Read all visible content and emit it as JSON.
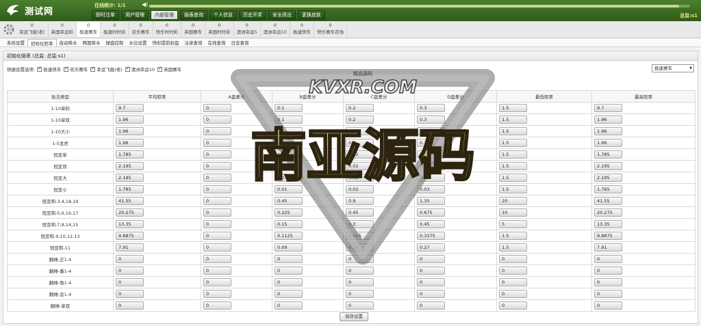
{
  "app": {
    "logo_text": "测试网",
    "online_text": "在线统计: 1/1",
    "balance_text": "总监:s1"
  },
  "progress": {
    "value_percent": 98
  },
  "nav": [
    {
      "label": "即时注单",
      "active": false
    },
    {
      "label": "用户管理",
      "active": false
    },
    {
      "label": "内部管理",
      "active": true
    },
    {
      "label": "报表查询",
      "active": false
    },
    {
      "label": "个人信息",
      "active": false
    },
    {
      "label": "历史开奖",
      "active": false
    },
    {
      "label": "安全退出",
      "active": false
    },
    {
      "label": "更换皮肤",
      "active": false
    }
  ],
  "games": [
    {
      "count": "0",
      "name": "幸运飞艇(老)",
      "active": false
    },
    {
      "count": "0",
      "name": "英国幸运彩",
      "active": false
    },
    {
      "count": "0",
      "name": "极速赛车",
      "active": true
    },
    {
      "count": "0",
      "name": "极速时时彩",
      "active": false
    },
    {
      "count": "0",
      "name": "欢乐赛车",
      "active": false
    },
    {
      "count": "0",
      "name": "快乐时时彩",
      "active": false
    },
    {
      "count": "0",
      "name": "英国赛车",
      "active": false
    },
    {
      "count": "0",
      "name": "英国时时彩",
      "active": false
    },
    {
      "count": "0",
      "name": "澳洲幸运5",
      "active": false
    },
    {
      "count": "0",
      "name": "澳洲幸运10",
      "active": false
    },
    {
      "count": "0",
      "name": "极速快车",
      "active": false
    },
    {
      "count": "0",
      "name": "快乐赛车农场",
      "active": false
    }
  ],
  "submenu": [
    {
      "label": "系统设置",
      "active": false
    },
    {
      "label": "初始化赔率",
      "active": true
    },
    {
      "label": "自动降水",
      "active": false
    },
    {
      "label": "两面降水",
      "active": false
    },
    {
      "label": "操盘控制",
      "active": false
    },
    {
      "label": "水位设置",
      "active": false
    },
    {
      "label": "快彩提前封盘",
      "active": false
    },
    {
      "label": "注单查询",
      "active": false
    },
    {
      "label": "在线查询",
      "active": false
    },
    {
      "label": "日志查询",
      "active": false
    }
  ],
  "panel": {
    "title": "初始化赔率 (总监: 总监:s1)",
    "quick_label": "快捷设置选项:",
    "quick_options": [
      "极速快车",
      "欢乐赛车",
      "幸运飞艇(老)",
      "澳洲幸运10",
      "英国赛车"
    ],
    "select_value": "极速赛车",
    "save_label": "保存设置"
  },
  "table": {
    "headers": [
      "玩法类型",
      "平均赔率",
      "A盘差分",
      "B盘差分",
      "C盘差分",
      "D盘差分",
      "最低赔率",
      "最高赔率"
    ],
    "rows": [
      [
        "1-10单码",
        "9.7",
        "0",
        "0.1",
        "0.2",
        "0.3",
        "1.5",
        "9.7"
      ],
      [
        "1-10单双",
        "1.96",
        "0",
        "0.1",
        "0.2",
        "0.3",
        "1.5",
        "1.96"
      ],
      [
        "1-10大小",
        "1.96",
        "0",
        "0.1",
        "0.2",
        "0.3",
        "1.5",
        "1.96"
      ],
      [
        "1-5龙虎",
        "1.96",
        "0",
        "0.1",
        "0.2",
        "0.3",
        "1.5",
        "1.96"
      ],
      [
        "冠亚单",
        "1.785",
        "0",
        "0.01",
        "0.02",
        "0.03",
        "1.5",
        "1.785"
      ],
      [
        "冠亚双",
        "2.195",
        "0",
        "0.01",
        "0.02",
        "0.03",
        "1.5",
        "2.195"
      ],
      [
        "冠亚大",
        "2.195",
        "0",
        "0.01",
        "0.02",
        "0.03",
        "1.5",
        "2.195"
      ],
      [
        "冠亚小",
        "1.785",
        "0",
        "0.01",
        "0.02",
        "0.03",
        "1.5",
        "1.765"
      ],
      [
        "冠亚和-3,4,18,19",
        "41.55",
        "0",
        "0.45",
        "0.9",
        "1.35",
        "20",
        "41.55"
      ],
      [
        "冠亚和-5,6,16,17",
        "20.275",
        "0",
        "0.225",
        "0.45",
        "0.675",
        "10",
        "20.275"
      ],
      [
        "冠亚和-7,8,14,15",
        "13.35",
        "0",
        "0.15",
        "0.3",
        "0.45",
        "5",
        "13.35"
      ],
      [
        "冠亚和-9,10,12,13",
        "9.8875",
        "0",
        "0.1125",
        "0.225",
        "0.3375",
        "1.5",
        "9.8875"
      ],
      [
        "冠亚和-11",
        "7.91",
        "0",
        "0.09",
        "0.18",
        "0.27",
        "1.5",
        "7.91"
      ],
      [
        "翻摊-正1-4",
        "0",
        "0",
        "0",
        "0",
        "0",
        "0",
        "0"
      ],
      [
        "翻摊-番1-4",
        "0",
        "0",
        "0",
        "0",
        "0",
        "0",
        "0"
      ],
      [
        "翻摊-角1-4",
        "0",
        "0",
        "0",
        "0",
        "0",
        "0",
        "0"
      ],
      [
        "翻摊-念1-4",
        "0",
        "0",
        "0",
        "0",
        "0",
        "0",
        "0"
      ],
      [
        "翻摊-单双",
        "0",
        "0",
        "0",
        "0",
        "0",
        "0",
        "0"
      ]
    ]
  },
  "watermark": {
    "top_text": "KVXR.COM",
    "main_text": "南亚源码",
    "small_text": "精品源码"
  }
}
